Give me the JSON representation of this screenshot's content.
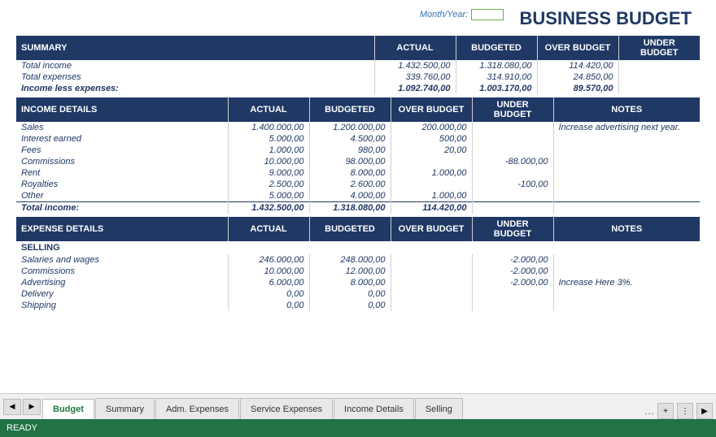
{
  "title": "BUSINESS BUDGET",
  "monthYear": {
    "label": "Month/Year:",
    "value": ""
  },
  "summary": {
    "sectionTitle": "SUMMARY",
    "columns": [
      "ACTUAL",
      "BUDGETED",
      "OVER BUDGET",
      "UNDER BUDGET"
    ],
    "rows": [
      {
        "label": "Total income",
        "actual": "1.432.500,00",
        "budgeted": "1.318.080,00",
        "over": "114.420,00",
        "under": ""
      },
      {
        "label": "Total expenses",
        "actual": "339.760,00",
        "budgeted": "314.910,00",
        "over": "24.850,00",
        "under": ""
      },
      {
        "label": "Income less expenses:",
        "actual": "1.092.740,00",
        "budgeted": "1.003.170,00",
        "over": "89.570,00",
        "under": "",
        "bold": true
      }
    ]
  },
  "incomeDetails": {
    "sectionTitle": "INCOME DETAILS",
    "columns": [
      "ACTUAL",
      "BUDGETED",
      "OVER BUDGET",
      "UNDER BUDGET",
      "NOTES"
    ],
    "rows": [
      {
        "label": "Sales",
        "actual": "1.400.000,00",
        "budgeted": "1.200.000,00",
        "over": "200.000,00",
        "under": "",
        "notes": "Increase advertising next year."
      },
      {
        "label": "Interest earned",
        "actual": "5.000,00",
        "budgeted": "4.500,00",
        "over": "500,00",
        "under": "",
        "notes": ""
      },
      {
        "label": "Fees",
        "actual": "1.000,00",
        "budgeted": "980,00",
        "over": "20,00",
        "under": "",
        "notes": ""
      },
      {
        "label": "Commissions",
        "actual": "10.000,00",
        "budgeted": "98.000,00",
        "over": "",
        "under": "-88.000,00",
        "notes": ""
      },
      {
        "label": "Rent",
        "actual": "9.000,00",
        "budgeted": "8.000,00",
        "over": "1.000,00",
        "under": "",
        "notes": ""
      },
      {
        "label": "Royalties",
        "actual": "2.500,00",
        "budgeted": "2.600,00",
        "over": "",
        "under": "-100,00",
        "notes": ""
      },
      {
        "label": "Other",
        "actual": "5.000,00",
        "budgeted": "4.000,00",
        "over": "1.000,00",
        "under": "",
        "notes": ""
      },
      {
        "label": "Total income:",
        "actual": "1.432.500,00",
        "budgeted": "1.318.080,00",
        "over": "114.420,00",
        "under": "",
        "notes": "",
        "total": true
      }
    ]
  },
  "expenseDetails": {
    "sectionTitle": "EXPENSE DETAILS",
    "columns": [
      "ACTUAL",
      "BUDGETED",
      "OVER BUDGET",
      "UNDER BUDGET",
      "NOTES"
    ],
    "subsections": [
      {
        "title": "SELLING",
        "rows": [
          {
            "label": "Salaries and wages",
            "actual": "246.000,00",
            "budgeted": "248.000,00",
            "over": "",
            "under": "-2.000,00",
            "notes": ""
          },
          {
            "label": "Commissions",
            "actual": "10.000,00",
            "budgeted": "12.000,00",
            "over": "",
            "under": "-2.000,00",
            "notes": ""
          },
          {
            "label": "Advertising",
            "actual": "6.000,00",
            "budgeted": "8.000,00",
            "over": "",
            "under": "-2.000,00",
            "notes": "Increase Here 3%."
          },
          {
            "label": "Delivery",
            "actual": "0,00",
            "budgeted": "0,00",
            "over": "",
            "under": "",
            "notes": ""
          },
          {
            "label": "Shipping",
            "actual": "0,00",
            "budgeted": "0,00",
            "over": "",
            "under": "",
            "notes": ""
          }
        ]
      }
    ]
  },
  "tabs": {
    "items": [
      {
        "label": "Budget",
        "active": true
      },
      {
        "label": "Summary",
        "active": false
      },
      {
        "label": "Adm. Expenses",
        "active": false
      },
      {
        "label": "Service Expenses",
        "active": false
      },
      {
        "label": "Income Details",
        "active": false
      },
      {
        "label": "Selling",
        "active": false
      }
    ]
  },
  "statusBar": {
    "label": "READY"
  }
}
